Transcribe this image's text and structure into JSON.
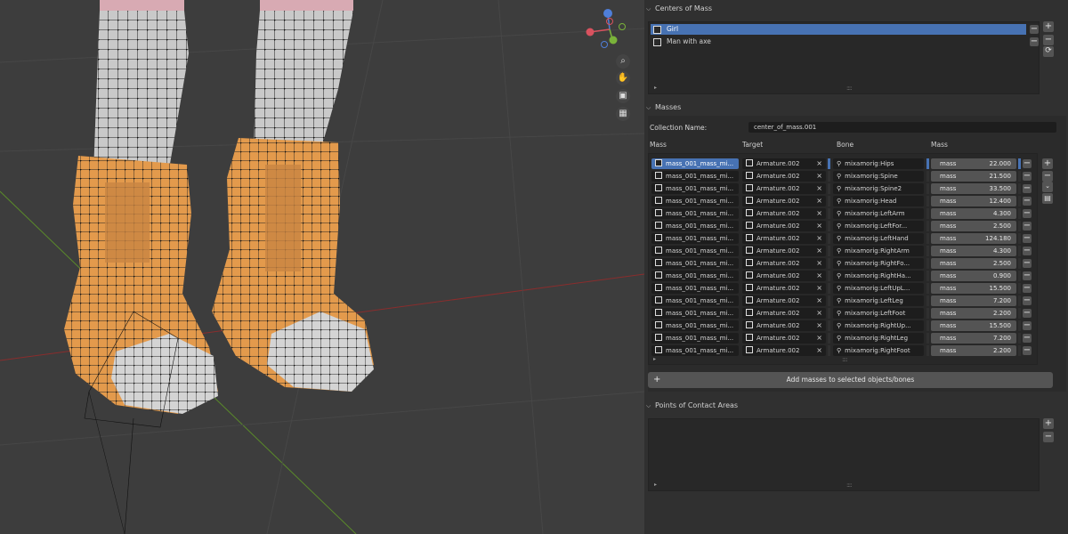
{
  "centers_of_mass": {
    "header": "Centers of Mass",
    "items": [
      {
        "label": "Girl",
        "selected": true
      },
      {
        "label": "Man with axe",
        "selected": false
      }
    ],
    "add_icon": "plus-icon",
    "remove_icon": "minus-icon",
    "refresh_icon": "refresh-icon"
  },
  "masses": {
    "header": "Masses",
    "collection_label": "Collection Name:",
    "collection_value": "center_of_mass.001",
    "columns": [
      "Mass",
      "Target",
      "Bone",
      "Mass"
    ],
    "rows": [
      {
        "name": "mass_001_mass_mi...",
        "target": "Armature.002",
        "bone": "mixamorig:Hips",
        "label": "mass",
        "value": "22.000"
      },
      {
        "name": "mass_001_mass_mi...",
        "target": "Armature.002",
        "bone": "mixamorig:Spine",
        "label": "mass",
        "value": "21.500"
      },
      {
        "name": "mass_001_mass_mi...",
        "target": "Armature.002",
        "bone": "mixamorig:Spine2",
        "label": "mass",
        "value": "33.500"
      },
      {
        "name": "mass_001_mass_mi...",
        "target": "Armature.002",
        "bone": "mixamorig:Head",
        "label": "mass",
        "value": "12.400"
      },
      {
        "name": "mass_001_mass_mi...",
        "target": "Armature.002",
        "bone": "mixamorig:LeftArm",
        "label": "mass",
        "value": "4.300"
      },
      {
        "name": "mass_001_mass_mi...",
        "target": "Armature.002",
        "bone": "mixamorig:LeftFor...",
        "label": "mass",
        "value": "2.500"
      },
      {
        "name": "mass_001_mass_mi...",
        "target": "Armature.002",
        "bone": "mixamorig:LeftHand",
        "label": "mass",
        "value": "124.180"
      },
      {
        "name": "mass_001_mass_mi...",
        "target": "Armature.002",
        "bone": "mixamorig:RightArm",
        "label": "mass",
        "value": "4.300"
      },
      {
        "name": "mass_001_mass_mi...",
        "target": "Armature.002",
        "bone": "mixamorig:RightFo...",
        "label": "mass",
        "value": "2.500"
      },
      {
        "name": "mass_001_mass_mi...",
        "target": "Armature.002",
        "bone": "mixamorig:RightHa...",
        "label": "mass",
        "value": "0.900"
      },
      {
        "name": "mass_001_mass_mi...",
        "target": "Armature.002",
        "bone": "mixamorig:LeftUpL...",
        "label": "mass",
        "value": "15.500"
      },
      {
        "name": "mass_001_mass_mi...",
        "target": "Armature.002",
        "bone": "mixamorig:LeftLeg",
        "label": "mass",
        "value": "7.200"
      },
      {
        "name": "mass_001_mass_mi...",
        "target": "Armature.002",
        "bone": "mixamorig:LeftFoot",
        "label": "mass",
        "value": "2.200"
      },
      {
        "name": "mass_001_mass_mi...",
        "target": "Armature.002",
        "bone": "mixamorig:RightUp...",
        "label": "mass",
        "value": "15.500"
      },
      {
        "name": "mass_001_mass_mi...",
        "target": "Armature.002",
        "bone": "mixamorig:RightLeg",
        "label": "mass",
        "value": "7.200"
      },
      {
        "name": "mass_001_mass_mi...",
        "target": "Armature.002",
        "bone": "mixamorig:RightFoot",
        "label": "mass",
        "value": "2.200"
      }
    ],
    "add_button": "Add masses to selected objects/bones",
    "add_icon": "plus-icon"
  },
  "points_of_contact": {
    "header": "Points of Contact Areas"
  },
  "viewport": {
    "gizmo_axes": [
      "X",
      "Y",
      "Z"
    ],
    "nav_icons": [
      "zoom-icon",
      "hand-icon",
      "camera-icon",
      "grid-icon"
    ]
  },
  "colors": {
    "accent": "#4772b3",
    "panel_bg": "#303030",
    "viewport_bg": "#3d3d3d",
    "boot_orange": "#e39a4c"
  }
}
